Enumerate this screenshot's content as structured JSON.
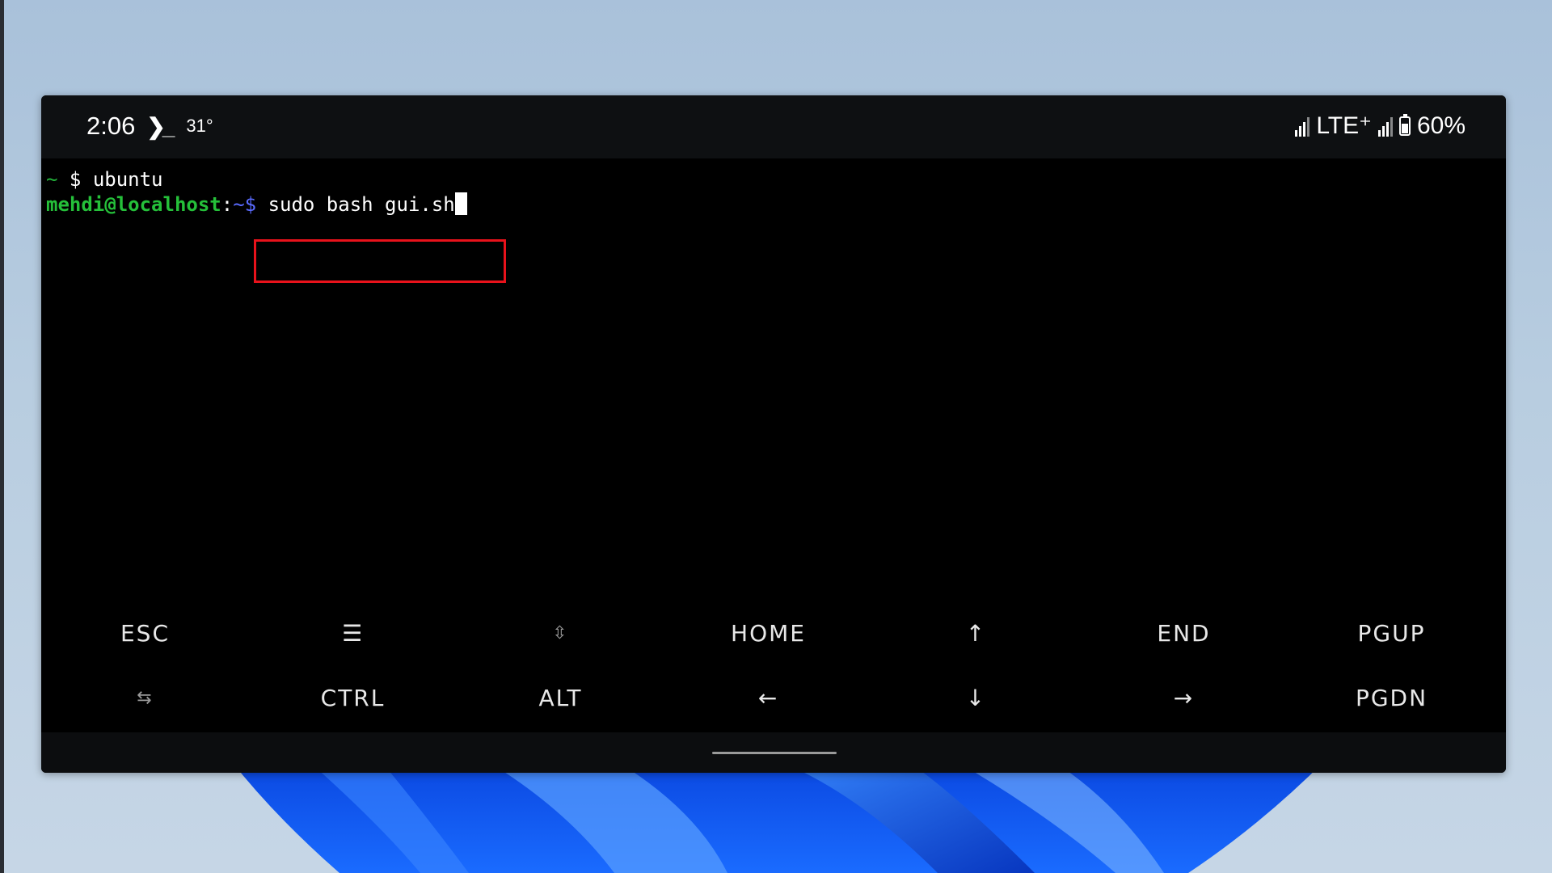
{
  "status_bar": {
    "time": "2:06",
    "terminal_indicator": "❯_",
    "temperature": "31°",
    "network": "LTE⁺",
    "battery": "60%"
  },
  "terminal": {
    "line1": {
      "tilde": "~",
      "dollar": "$",
      "command": "ubuntu"
    },
    "line2": {
      "user_host": "mehdi@localhost",
      "colon": ":",
      "path": "~$",
      "command": "sudo bash gui.sh"
    }
  },
  "extra_keys": {
    "row1": [
      "ESC",
      "☰",
      "⇳",
      "HOME",
      "↑",
      "END",
      "PGUP"
    ],
    "row2": [
      "⇆",
      "CTRL",
      "ALT",
      "←",
      "↓",
      "→",
      "PGDN"
    ]
  },
  "colors": {
    "highlight": "#e8121b",
    "prompt_user": "#25c03a",
    "prompt_path": "#5a6bff"
  }
}
